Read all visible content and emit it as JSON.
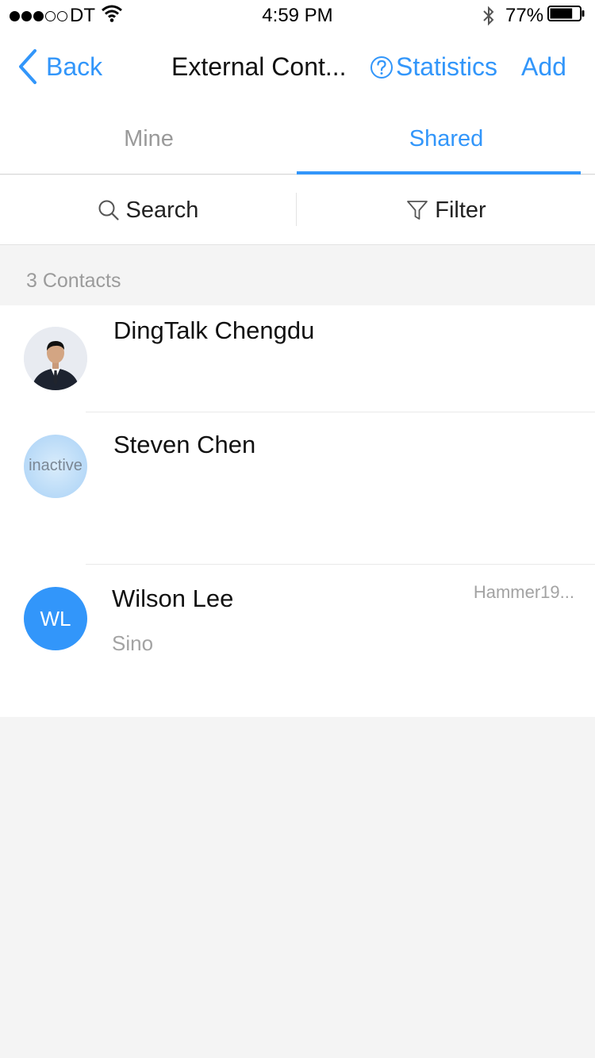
{
  "status_bar": {
    "carrier": "DT",
    "time": "4:59 PM",
    "battery": "77%",
    "battery_level": 0.77,
    "signal_bars_filled": 3,
    "signal_bars_total": 5
  },
  "nav": {
    "back_label": "Back",
    "title": "External Cont...",
    "statistics_label": "Statistics",
    "add_label": "Add"
  },
  "tabs": [
    {
      "label": "Mine",
      "active": false
    },
    {
      "label": "Shared",
      "active": true
    }
  ],
  "tools": {
    "search_label": "Search",
    "filter_label": "Filter"
  },
  "contacts_count_label": "3 Contacts",
  "contacts": [
    {
      "name": "DingTalk Chengdu",
      "avatar": "photo",
      "company": "",
      "meta": ""
    },
    {
      "name": "Steven Chen",
      "avatar": "inactive",
      "avatar_text": "inactive",
      "company": "",
      "meta": ""
    },
    {
      "name": "Wilson Lee",
      "avatar": "initials",
      "initials": "WL",
      "company": "Sino",
      "meta": "Hammer19..."
    }
  ],
  "colors": {
    "accent": "#3296fa",
    "muted_text": "#9b9b9b",
    "background": "#f4f4f4"
  },
  "icons": [
    "back-chevron-icon",
    "question-circle-icon",
    "search-icon",
    "filter-icon",
    "wifi-icon",
    "bluetooth-icon",
    "battery-icon"
  ]
}
